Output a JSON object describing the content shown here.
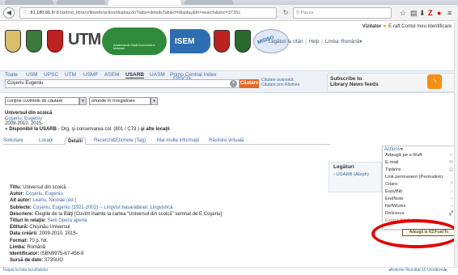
{
  "browser": {
    "url_prefix": "81.180.66.9",
    "url_path": "/:81/primo_library/libweb/action/display.do?tabs=detailsTab&ct=display&fn=search&doc=373SL",
    "search_placeholder": "Pauza"
  },
  "usernav": {
    "visitor": "Vizitator",
    "eraft": "E-raft",
    "account": "Contul meu",
    "login": "Identificare"
  },
  "links": {
    "item1": "Legături la citări",
    "item2": "Help",
    "language": "Limba: Română"
  },
  "logos": {
    "tum": "UTM",
    "asem_tag": "Academia de Studii Economice a Moldovei",
    "isem": "ISEM",
    "misiso": "MISISO"
  },
  "scopes": [
    "Toate",
    "USM",
    "UPSC",
    "UTM",
    "USMF",
    "ASEM",
    "USARB",
    "UASM",
    "Primo Central Index"
  ],
  "scope_extra": "EBSCO",
  "search": {
    "value": "Coşeriu Eugeniu",
    "go": "Căutare",
    "adv1": "Căutare avansată",
    "adv2": "Căutare prin Răsfoire"
  },
  "rss": {
    "line1": "Subscribe to",
    "line2": "Library News feeds"
  },
  "filters": {
    "f1": "conţine cuvintele de căutare",
    "f2": "oriunde în înregistrare"
  },
  "record": {
    "title": "Universul din scoică",
    "author": "Coşeriu, Eugeniu",
    "years": "2009-2010. 2015-",
    "avail_label": "Disponibil la",
    "avail_lib": "USARB",
    "avail_rest": " - Org. şi conservarea col.  (801 / C73 )",
    "avail_more": "şi alte locaţii"
  },
  "tabs": [
    "Solicitare",
    "Locaţii",
    "Detalii",
    "Recenzii&Etichete (Tag)",
    "Mai multe informaţii",
    "Răsfoire virtuală"
  ],
  "details": {
    "titlu_k": "Titlu:",
    "titlu_v": "Universul din scoică",
    "autor_k": "Autor:",
    "autor_v": "Coşeriu, Eugeniu",
    "alt_k": "Alt autor:",
    "alt_v": "Leahu, Nicolae (ed.)",
    "subj_k": "Subiecte:",
    "subj_v1": "Coşeriu, Eugeniu",
    "subj_v2": "(1921-2002) -- Lingvist basarabean; Lingvistică",
    "desc_k": "Descriere:",
    "desc_v": "Elegiile de la Bălţi  [Cuvînt înainte la cartea \"Universul din scoică\" semnat de E.Coşeriu]",
    "tit_k": "Titluri în relaţie:",
    "tit_v": "Serii Opera aperta",
    "edit_k": "Editură:",
    "edit_v": "Chişinău Universul",
    "data_k": "Data creării:",
    "data_v": "2009-2010. 2015-",
    "fmt_k": "Format:",
    "fmt_v": "70 p. fot.",
    "lim_k": "Limba:",
    "lim_v": "Română",
    "id_k": "Identificator:",
    "id_v": "ISBN9975-67-456-9",
    "src_k": "Sursă de date:",
    "src_v": "373SUO"
  },
  "legaturi": {
    "heading": "Legături",
    "link": "USARB (Aleph)"
  },
  "actions": {
    "heading": "Actions",
    "items": [
      "Adaugă pe e-Raft",
      "E-mail",
      "Tipărire",
      "Link permanent (Permalink)",
      "Citare",
      "EasyBib",
      "EndNote",
      "RefWorks",
      "Delicious",
      "Export BibTeX"
    ],
    "tooltip": "Adaugă la RZ/Fuel/To"
  },
  "footer": {
    "left": "Înapoi la lista rezultatelor",
    "right": "◂Anterior Rezultat 15 Următorul▸"
  }
}
